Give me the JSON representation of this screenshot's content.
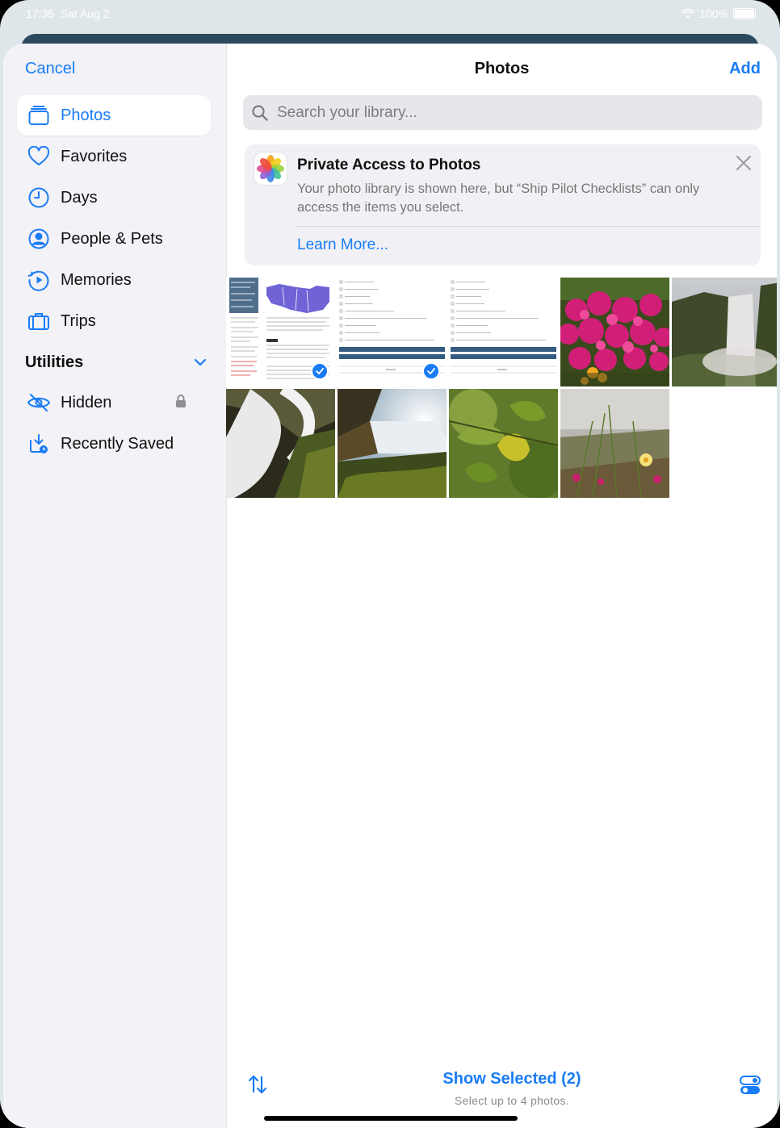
{
  "status": {
    "time": "17:35",
    "date": "Sat Aug 2",
    "battery": "100%"
  },
  "sidebar": {
    "cancel_label": "Cancel",
    "items": [
      {
        "label": "Photos",
        "icon": "photos-stack-icon",
        "selected": true
      },
      {
        "label": "Favorites",
        "icon": "heart-icon"
      },
      {
        "label": "Days",
        "icon": "clock-icon"
      },
      {
        "label": "People & Pets",
        "icon": "person-circle-icon"
      },
      {
        "label": "Memories",
        "icon": "memories-play-icon"
      },
      {
        "label": "Trips",
        "icon": "suitcase-icon"
      }
    ],
    "utilities_title": "Utilities",
    "utilities": [
      {
        "label": "Hidden",
        "icon": "eye-slash-icon",
        "locked": true
      },
      {
        "label": "Recently Saved",
        "icon": "download-tray-icon"
      }
    ]
  },
  "main": {
    "title": "Photos",
    "add_label": "Add",
    "search_placeholder": "Search your library...",
    "notice": {
      "title": "Private Access to Photos",
      "body": "Your photo library is shown here, but “Ship Pilot Checklists” can only access the items you select.",
      "link": "Learn More..."
    },
    "photos": [
      {
        "kind": "document-map",
        "selected": true
      },
      {
        "kind": "checklist",
        "selected": true
      },
      {
        "kind": "checklist",
        "selected": false
      },
      {
        "kind": "pink-flowers",
        "selected": false
      },
      {
        "kind": "waterfall-mist",
        "selected": false
      },
      {
        "kind": "rocky-waterfall",
        "selected": false
      },
      {
        "kind": "sunlit-waterfall",
        "selected": false
      },
      {
        "kind": "green-leaves",
        "selected": false
      },
      {
        "kind": "yellow-flower-grass",
        "selected": false
      }
    ],
    "show_selected_label": "Show Selected (2)",
    "limit_text": "Select up to 4 photos."
  },
  "colors": {
    "accent": "#1a7cf5",
    "sidebar_bg": "#f2f2f7"
  }
}
